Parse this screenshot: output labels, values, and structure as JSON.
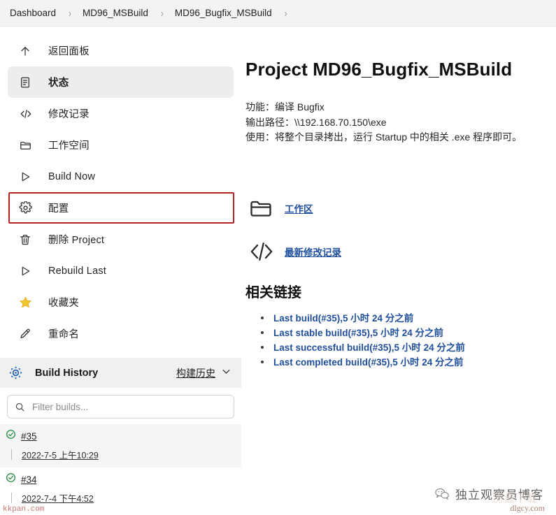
{
  "breadcrumb": {
    "items": [
      "Dashboard",
      "MD96_MSBuild",
      "MD96_Bugfix_MSBuild"
    ],
    "separator": "›"
  },
  "sidebar": {
    "items": [
      {
        "label": "返回面板",
        "icon": "arrow-up-icon",
        "state": "normal"
      },
      {
        "label": "状态",
        "icon": "status-document-icon",
        "state": "selected"
      },
      {
        "label": "修改记录",
        "icon": "code-brackets-icon",
        "state": "normal"
      },
      {
        "label": "工作空间",
        "icon": "folder-icon",
        "state": "normal"
      },
      {
        "label": "Build Now",
        "icon": "play-triangle-icon",
        "state": "normal"
      },
      {
        "label": "配置",
        "icon": "gear-icon",
        "state": "highlighted"
      },
      {
        "label": "删除 Project",
        "icon": "trash-icon",
        "state": "normal"
      },
      {
        "label": "Rebuild Last",
        "icon": "play-triangle-icon",
        "state": "normal"
      },
      {
        "label": "收藏夹",
        "icon": "star-icon",
        "state": "normal"
      },
      {
        "label": "重命名",
        "icon": "pencil-icon",
        "state": "normal"
      }
    ],
    "highlight_color": "#b42424",
    "star_color": "#f2c430"
  },
  "build_history": {
    "icon": "jenkins-build-icon",
    "title": "Build History",
    "link_label": "构建历史",
    "chevron": "chevron-down-icon",
    "filter": {
      "placeholder": "Filter builds...",
      "value": "",
      "icon": "search-icon"
    },
    "builds": [
      {
        "status": "success",
        "number": "#35",
        "date": "2022-7-5 上午10:29"
      },
      {
        "status": "success",
        "number": "#34",
        "date": "2022-7-4 下午4:52"
      }
    ],
    "success_color": "#1a8a3c"
  },
  "main": {
    "title": "Project MD96_Bugfix_MSBuild",
    "description_lines": [
      "功能：编译 Bugfix",
      "输出路径：\\\\192.168.70.150\\exe",
      "使用：将整个目录拷出，运行 Startup 中的相关 .exe 程序即可。"
    ],
    "quick_links": [
      {
        "icon": "folder-icon",
        "label": "工作区"
      },
      {
        "icon": "code-brackets-icon",
        "label": "最新修改记录"
      }
    ],
    "related_section_title": "相关链接",
    "related_links": [
      "Last build(#35),5 小时 24 分之前",
      "Last stable build(#35),5 小时 24 分之前",
      "Last successful build(#35),5 小时 24 分之前",
      "Last completed build(#35),5 小时 24 分之前"
    ],
    "link_color": "#1f4e9c"
  },
  "watermarks": {
    "blog_name": "独立观察员博客",
    "blog_icon": "wechat-logo-icon",
    "domain": "dlgcy.com",
    "ghost": "历盘下载",
    "corner": "kkpan.com"
  }
}
